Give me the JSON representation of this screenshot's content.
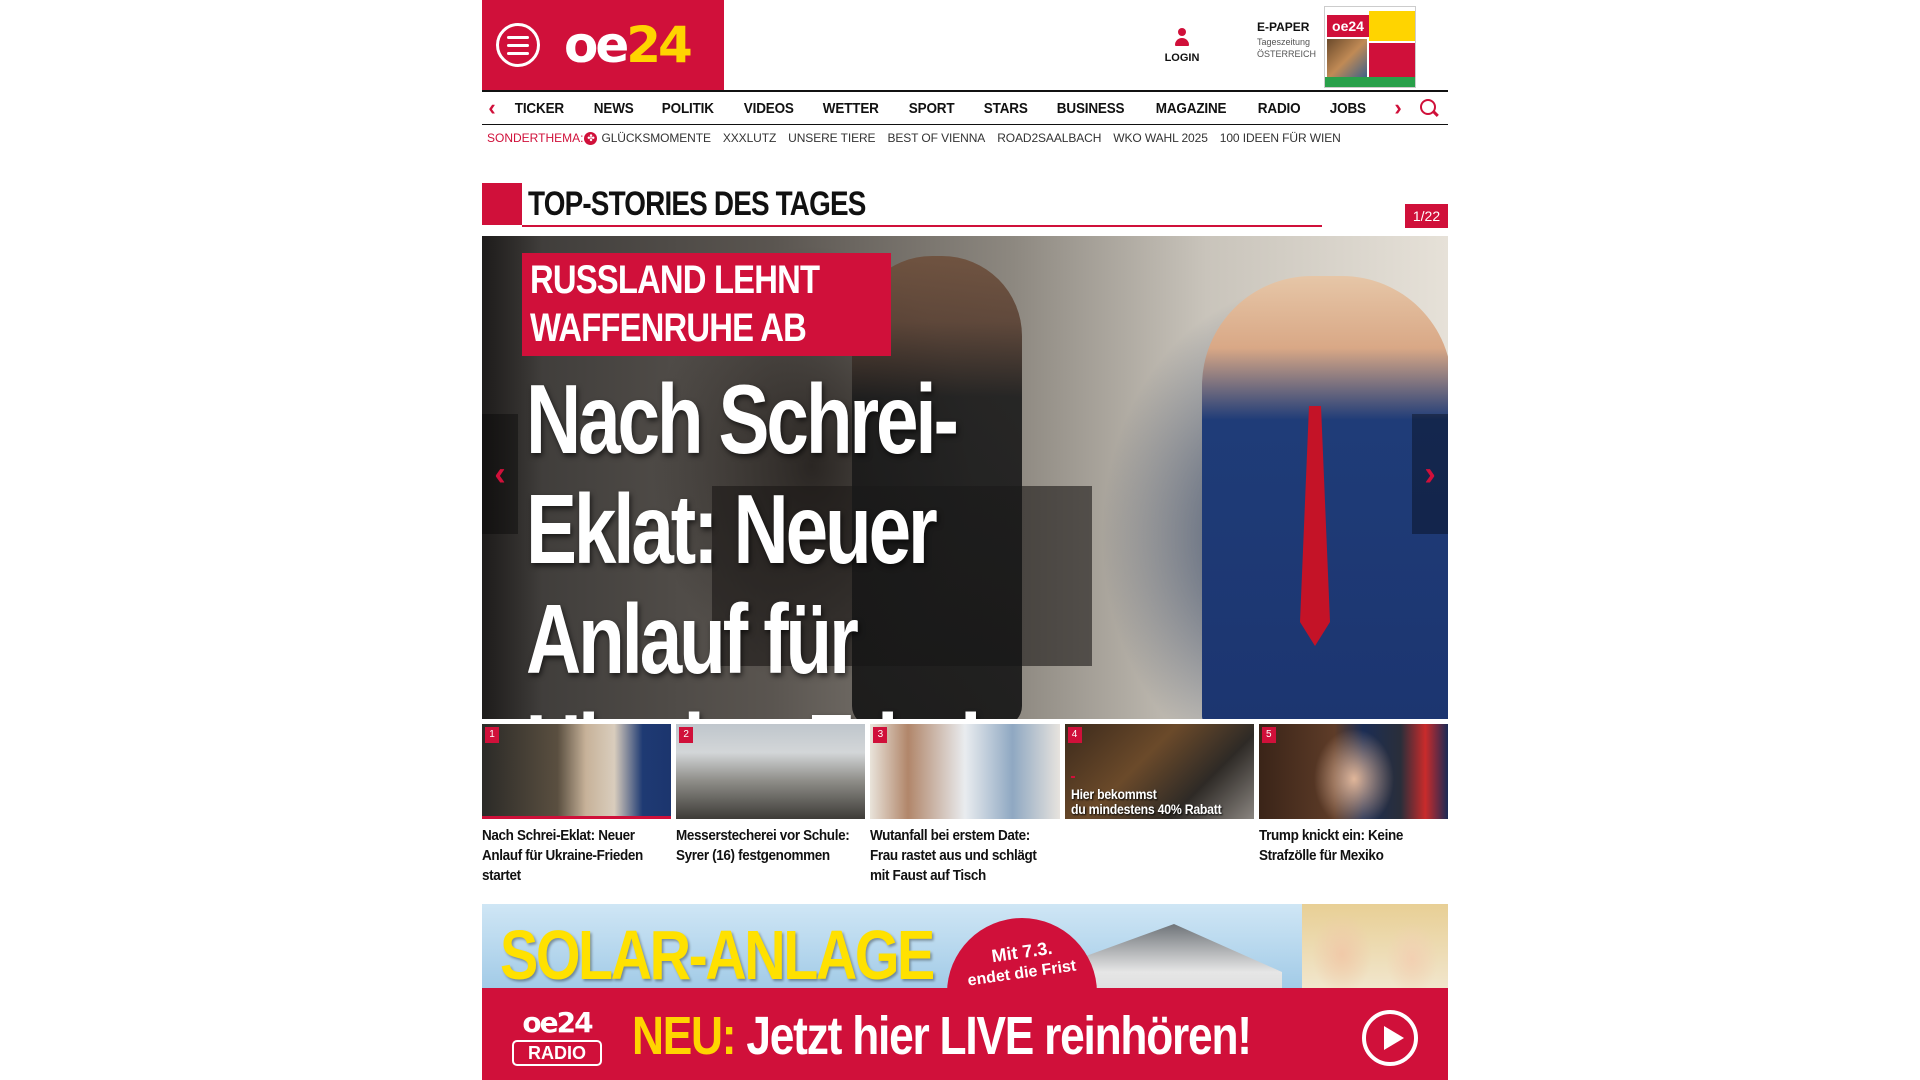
{
  "header": {
    "logo": {
      "prefix": "oe",
      "number": "24"
    },
    "login_label": "LOGIN",
    "epaper": {
      "title": "E-PAPER",
      "line1": "Tageszeitung",
      "line2": "ÖSTERREICH",
      "cover_logo": "oe24"
    }
  },
  "nav": {
    "items": [
      "TICKER",
      "NEWS",
      "POLITIK",
      "VIDEOS",
      "WETTER",
      "SPORT",
      "STARS",
      "BUSINESS",
      "MAGAZINE",
      "RADIO",
      "JOBS"
    ]
  },
  "subnav": {
    "label": "SONDERTHEMA:",
    "topics": [
      "GLÜCKSMOMENTE",
      "XXXLUTZ",
      "UNSERE TIERE",
      "BEST OF VIENNA",
      "ROAD2SAALBACH",
      "WKO WAHL 2025",
      "100 IDEEN FÜR WIEN"
    ]
  },
  "section": {
    "title": "TOP-STORIES DES TAGES",
    "counter": "1/22"
  },
  "hero": {
    "kicker_line1": "RUSSLAND LEHNT",
    "kicker_line2": "WAFFENRUHE AB",
    "headline_line1": "Nach Schrei-",
    "headline_line2": "Eklat: Neuer Anlauf für",
    "headline_line3": "Ukraine-Frieden startet"
  },
  "thumbs": [
    {
      "num": "1",
      "caption": "Nach Schrei-Eklat: Neuer Anlauf für Ukraine-Frieden startet"
    },
    {
      "num": "2",
      "caption": "Messerstecherei vor Schule: Syrer (16) festgenommen"
    },
    {
      "num": "3",
      "caption": "Wutanfall bei erstem Date: Frau rastet aus und schlägt mit Faust auf Tisch"
    },
    {
      "num": "4",
      "caption": "",
      "ad_line1": "Hier bekommst",
      "ad_line2": "du mindestens 40% Rabatt"
    },
    {
      "num": "5",
      "caption": "Trump knickt ein: Keine Strafzölle für Mexiko"
    }
  ],
  "ad": {
    "headline": "SOLAR-ANLAGE",
    "badge_line1": "Mit 7.3.",
    "badge_line2": "endet die Frist"
  },
  "radio": {
    "logo_top": "oe24",
    "logo_bottom": "RADIO",
    "neu": "NEU:",
    "text": " Jetzt hier LIVE reinhören!"
  },
  "colors": {
    "brand_red": "#d0103a",
    "brand_yellow": "#ffd400"
  }
}
